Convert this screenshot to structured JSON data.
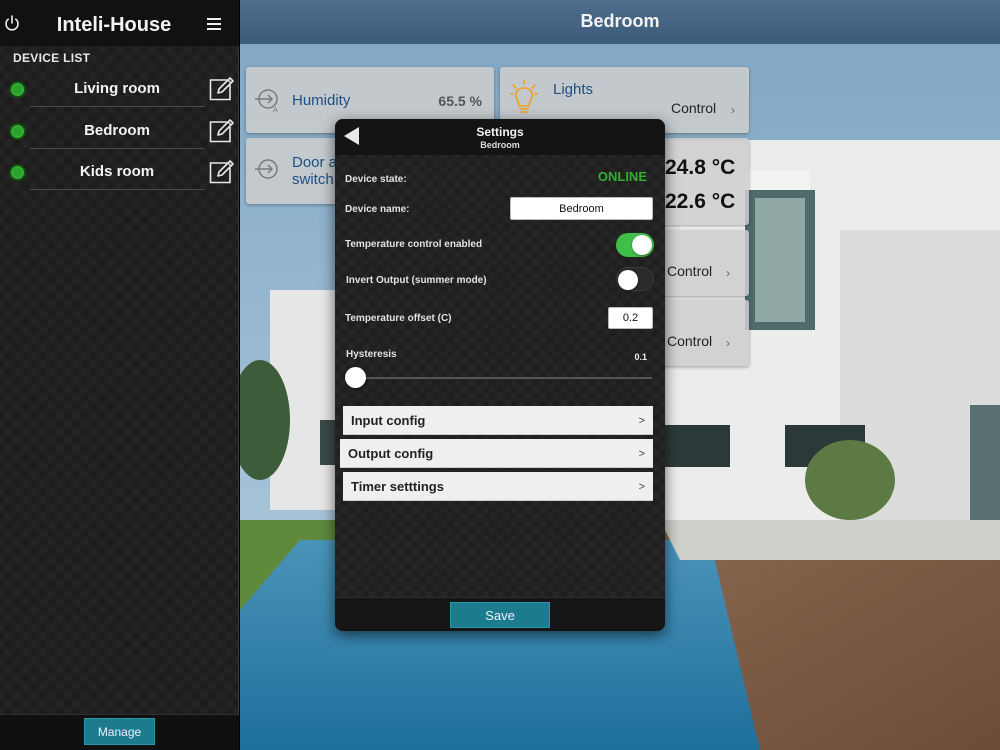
{
  "sidebar": {
    "title": "Inteli-House",
    "section_label": "DEVICE LIST",
    "devices": [
      {
        "name": "Living room",
        "status_color": "#27a327"
      },
      {
        "name": "Bedroom",
        "status_color": "#27a327"
      },
      {
        "name": "Kids room",
        "status_color": "#27a327"
      }
    ],
    "manage_label": "Manage"
  },
  "main": {
    "title": "Bedroom",
    "tiles": {
      "humidity": {
        "label": "Humidity",
        "value": "65.5 %",
        "icon": "sensor-icon"
      },
      "lights": {
        "label": "Lights",
        "control": "Control",
        "chevron": "›",
        "icon": "lightbulb-icon"
      },
      "door": {
        "label_line1": "Door al",
        "label_line2": "switch",
        "icon": "sensor-icon"
      },
      "temperature": {
        "value1": "24.8 °C",
        "value2": "22.6 °C"
      },
      "control_a": {
        "control": "Control",
        "chevron": "›"
      },
      "control_b": {
        "control": "Control",
        "chevron": "›"
      }
    }
  },
  "settings": {
    "title": "Settings",
    "subtitle": "Bedroom",
    "device_state_label": "Device state:",
    "device_state_value": "ONLINE",
    "device_name_label": "Device name:",
    "device_name_value": "Bedroom",
    "temp_control_label": "Temperature control enabled",
    "temp_control_on": true,
    "invert_label": "Invert Output (summer mode)",
    "invert_on": false,
    "offset_label": "Temperature offset (C)",
    "offset_value": "0.2",
    "hysteresis_label": "Hysteresis",
    "hysteresis_value": "0.1",
    "hysteresis_fraction": 0.0,
    "config_rows": [
      {
        "label": "Input config",
        "chevron": ">"
      },
      {
        "label": "Output config",
        "chevron": ">"
      },
      {
        "label": "Timer setttings",
        "chevron": ">"
      }
    ],
    "save_label": "Save"
  },
  "colors": {
    "accent_teal": "#1c7c8e",
    "online_green": "#2fb02f",
    "toggle_on": "#3fbf4a",
    "header_blue": "#4a6a8a"
  }
}
